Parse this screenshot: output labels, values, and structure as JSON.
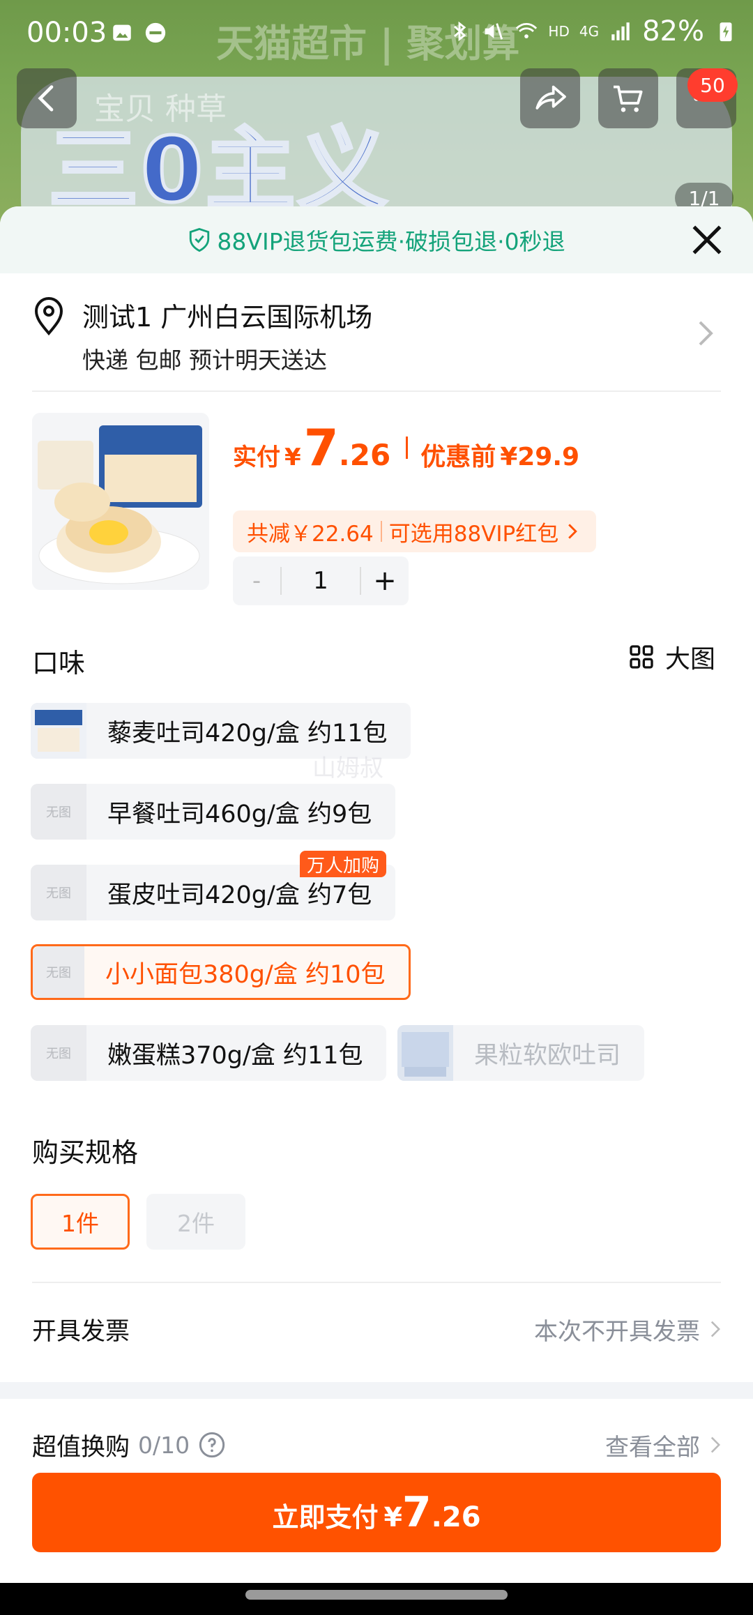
{
  "status_bar": {
    "time": "00:03",
    "battery": "82%",
    "network": "4G",
    "hd": "HD"
  },
  "background": {
    "banner_title": "天猫超市 | 聚划算",
    "promo_text": "三0主义",
    "tabs": "宝贝  种草",
    "cart_badge": "50",
    "pager": "1/1"
  },
  "sheet": {
    "vip_notice": "88VIP退货包运费·破损包退·0秒退",
    "address": {
      "line1": "测试1 广州白云国际机场",
      "line2": "快递 包邮 预计明天送达"
    },
    "product": {
      "price_label": "实付",
      "currency": "¥",
      "price_int": "7",
      "price_dec": ".26",
      "before_label": "优惠前",
      "before_price": "¥29.9",
      "discount_text": "共减￥22.64",
      "vip_coupon": "可选用88VIP红包",
      "quantity": "1",
      "minus": "-",
      "plus": "+"
    },
    "flavor": {
      "title": "口味",
      "big_image_label": "大图",
      "no_image": "无图",
      "options": [
        {
          "label": "藜麦吐司420g/盒 约11包"
        },
        {
          "label": "早餐吐司460g/盒 约9包"
        },
        {
          "label": "蛋皮吐司420g/盒 约7包",
          "tag": "万人加购"
        },
        {
          "label": "小小面包380g/盒 约10包",
          "selected": true
        },
        {
          "label": "嫩蛋糕370g/盒 约11包"
        },
        {
          "label": "果粒软欧吐司",
          "disabled": true
        }
      ],
      "watermark": "山姆叔"
    },
    "spec": {
      "title": "购买规格",
      "options": [
        {
          "label": "1件",
          "selected": true
        },
        {
          "label": "2件",
          "disabled": true
        }
      ]
    },
    "invoice": {
      "label": "开具发票",
      "value": "本次不开具发票"
    },
    "exchange": {
      "label": "超值换购",
      "count": "0/10",
      "view_all": "查看全部"
    },
    "pay_button": {
      "label": "立即支付",
      "currency": "¥",
      "int": "7",
      "dec": ".26"
    }
  },
  "colors": {
    "accent": "#ff5000",
    "vip_green": "#14a37a",
    "selected_border": "#ff6a1a"
  }
}
